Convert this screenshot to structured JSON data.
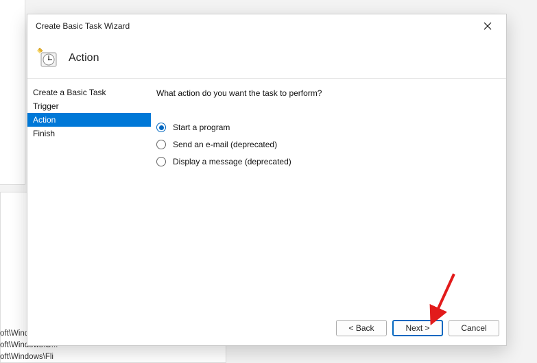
{
  "background": {
    "line1": "oft\\Windc",
    "line2": "oft\\Windows\\O...",
    "line3": "oft\\Windows\\Fli"
  },
  "dialog": {
    "title": "Create Basic Task Wizard",
    "header": "Action",
    "sidebar": {
      "items": [
        {
          "label": "Create a Basic Task",
          "selected": false
        },
        {
          "label": "Trigger",
          "selected": false
        },
        {
          "label": "Action",
          "selected": true
        },
        {
          "label": "Finish",
          "selected": false
        }
      ]
    },
    "content": {
      "prompt": "What action do you want the task to perform?",
      "options": [
        {
          "label": "Start a program",
          "checked": true
        },
        {
          "label": "Send an e-mail (deprecated)",
          "checked": false
        },
        {
          "label": "Display a message (deprecated)",
          "checked": false
        }
      ]
    },
    "footer": {
      "back": "< Back",
      "next": "Next >",
      "cancel": "Cancel"
    }
  }
}
